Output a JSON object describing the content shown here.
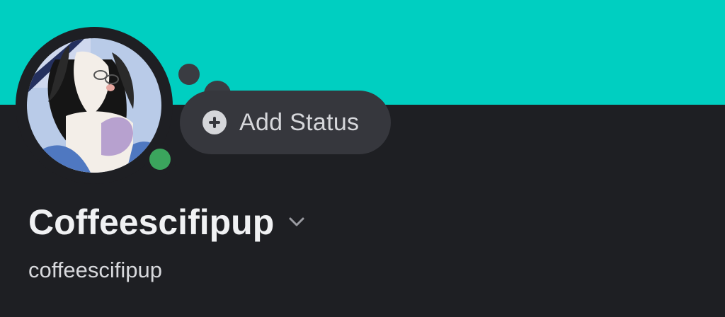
{
  "colors": {
    "banner": "#00cfc1",
    "background": "#1e1f23",
    "online": "#3ba55d",
    "status_bubble": "#36373d"
  },
  "avatar": {
    "icon": "user-avatar-illustration",
    "presence": "online"
  },
  "status": {
    "icon": "plus-circle-icon",
    "label": "Add Status"
  },
  "profile": {
    "display_name": "Coffeescifipup",
    "username": "coffeescifipup",
    "expand_icon": "chevron-down-icon"
  }
}
